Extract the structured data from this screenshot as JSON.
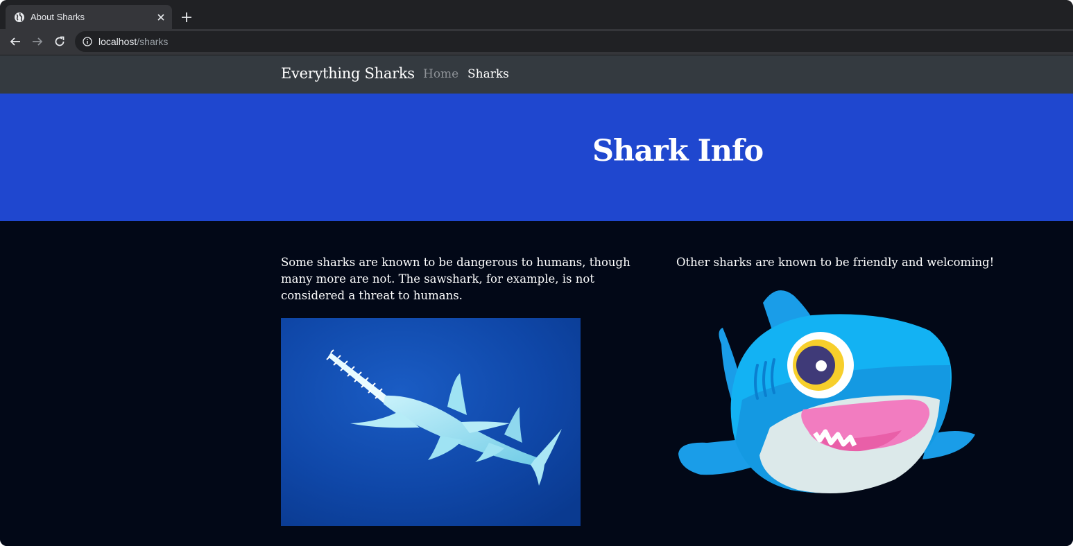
{
  "browser": {
    "tab_title": "About Sharks",
    "url_host": "localhost",
    "url_path": "/sharks"
  },
  "navbar": {
    "brand": "Everything Sharks",
    "links": [
      "Home",
      "Sharks"
    ],
    "active": "Sharks"
  },
  "hero": {
    "title": "Shark Info"
  },
  "content": {
    "left_text": "Some sharks are known to be dangerous to humans, though many more are not. The sawshark, for example, is not considered a threat to humans.",
    "right_text": "Other sharks are known to be friendly and welcoming!"
  },
  "colors": {
    "hero_bg": "#1f47cf",
    "navbar_bg": "#343a40",
    "page_bg": "#020817"
  }
}
